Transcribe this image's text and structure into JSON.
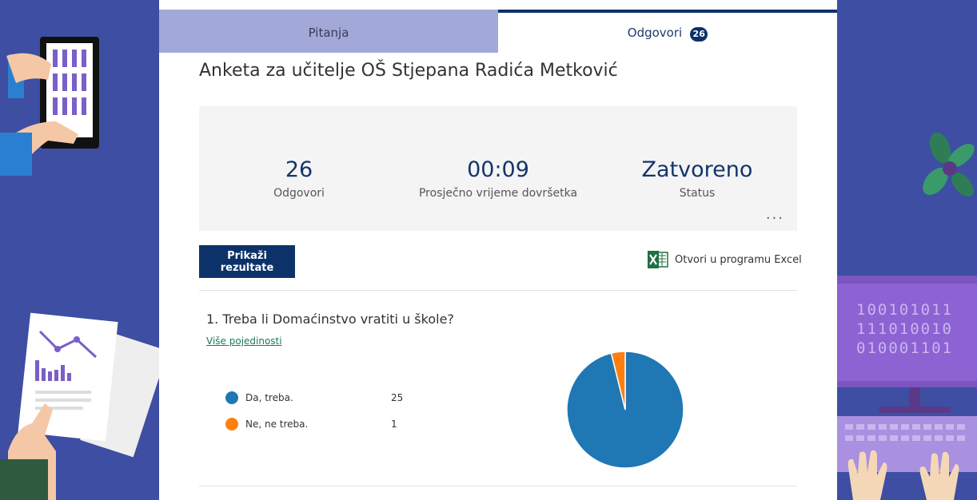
{
  "tabs": [
    {
      "label": "Pitanja"
    },
    {
      "label": "Odgovori",
      "badge": "26"
    }
  ],
  "form": {
    "title": "Anketa za učitelje OŠ Stjepana Radića Metković"
  },
  "summary": {
    "responses": {
      "value": "26",
      "label": "Odgovori"
    },
    "avg_time": {
      "value": "00:09",
      "label": "Prosječno vrijeme dovršetka"
    },
    "status": {
      "value": "Zatvoreno",
      "label": "Status"
    },
    "more_label": "..."
  },
  "actions": {
    "view_results": "Prikaži rezultate",
    "open_excel": "Otvori u programu Excel"
  },
  "question": {
    "text": "1. Treba li Domaćinstvo vratiti u škole?",
    "details_link": "Više pojedinosti",
    "options": [
      {
        "label": "Da, treba.",
        "count": "25",
        "color": "#1f77b4"
      },
      {
        "label": "Ne, ne treba.",
        "count": "1",
        "color": "#ff7f0e"
      }
    ]
  },
  "chart_data": {
    "type": "pie",
    "categories": [
      "Da, treba.",
      "Ne, ne treba."
    ],
    "values": [
      25,
      1
    ],
    "colors": [
      "#1f77b4",
      "#ff7f0e"
    ]
  },
  "background": {
    "binary_lines": [
      "100101011",
      "111010010",
      "010001101"
    ]
  },
  "colors": {
    "accent": "#0d3269",
    "background": "#3d4ea3",
    "tab_inactive": "#a2a8d8"
  }
}
